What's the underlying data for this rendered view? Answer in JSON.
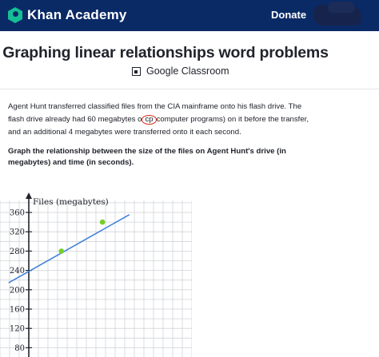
{
  "header": {
    "brand": "Khan Academy",
    "donate_label": "Donate",
    "logo_icon": "khan-academy-hexagon-icon"
  },
  "page": {
    "title": "Graphing linear relationships word problems",
    "google_classroom_label": "Google Classroom",
    "google_classroom_icon": "google-classroom-icon"
  },
  "problem": {
    "p1": "Agent Hunt transferred classified files from the CIA mainframe onto his flash drive. The flash drive already had ",
    "initial_value": "60",
    "p2": " megabytes o",
    "circled_text": "cp",
    "p3": "computer programs) on it before the transfer, and an additional ",
    "rate_value": "4",
    "p4": " megabytes were transferred onto it each second."
  },
  "question": "Graph the relationship between the size of the files on Agent Hunt's drive (in megabytes) and time (in seconds).",
  "chart_data": {
    "type": "line",
    "ylabel": "Files (megabytes)",
    "y_ticks": [
      80,
      120,
      160,
      200,
      240,
      280,
      320,
      360
    ],
    "y_tick_labels": [
      "80",
      "120",
      "160",
      "200",
      "240",
      "280",
      "320",
      "360"
    ],
    "ylim": [
      60,
      390
    ],
    "line": {
      "slope": 22.4,
      "intercept": 238,
      "x_start": -1.05,
      "x_end": 5.24
    },
    "points": [
      {
        "x": 1.7,
        "y": 280
      },
      {
        "x": 3.84,
        "y": 340
      }
    ],
    "grid": true,
    "colors": {
      "line": "#3d7fd9",
      "point": "#74cf28",
      "grid": "#d0d3d8",
      "axis": "#21242c",
      "circle": "#d92916"
    }
  }
}
